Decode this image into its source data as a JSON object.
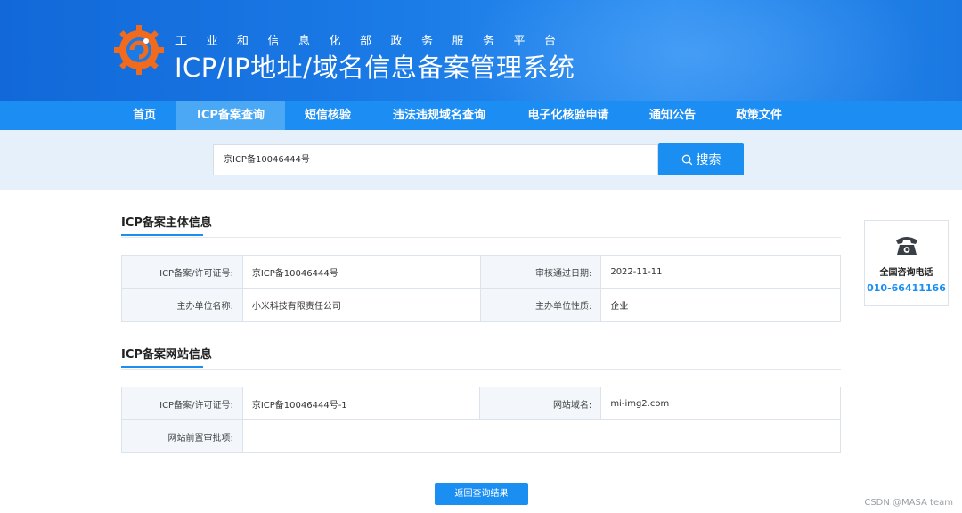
{
  "header": {
    "subtitle": "工业和信息化部政务服务平台",
    "title": "ICP/IP地址/域名信息备案管理系统"
  },
  "nav": {
    "items": [
      {
        "label": "首页"
      },
      {
        "label": "ICP备案查询",
        "active": true
      },
      {
        "label": "短信核验"
      },
      {
        "label": "违法违规域名查询"
      },
      {
        "label": "电子化核验申请"
      },
      {
        "label": "通知公告"
      },
      {
        "label": "政策文件"
      }
    ]
  },
  "search": {
    "value": "京ICP备10046444号",
    "button_label": "搜索",
    "button_icon": "search-icon"
  },
  "subject_info": {
    "title": "ICP备案主体信息",
    "rows": [
      {
        "label1": "ICP备案/许可证号:",
        "value1": "京ICP备10046444号",
        "label2": "审核通过日期:",
        "value2": "2022-11-11"
      },
      {
        "label1": "主办单位名称:",
        "value1": "小米科技有限责任公司",
        "label2": "主办单位性质:",
        "value2": "企业"
      }
    ]
  },
  "website_info": {
    "title": "ICP备案网站信息",
    "rows": [
      {
        "label1": "ICP备案/许可证号:",
        "value1": "京ICP备10046444号-1",
        "label2": "网站域名:",
        "value2": "mi-img2.com"
      },
      {
        "label1": "网站前置审批项:",
        "value1": ""
      }
    ]
  },
  "back_button": {
    "label": "返回查询结果"
  },
  "contact": {
    "icon": "telephone-icon",
    "label": "全国咨询电话",
    "number": "010-66411166"
  },
  "watermark": "CSDN @MASA team",
  "colors": {
    "primary": "#1b8ef2",
    "banner": "#1a7ae6",
    "nav_active": "#4aa8f5",
    "band": "#e5f0fa"
  }
}
